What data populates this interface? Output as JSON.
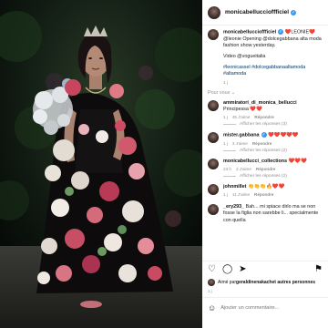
{
  "post": {
    "author": "monicabelluccioffficiel",
    "caption": {
      "author": "monicabelluccioffficiel",
      "text": "❤️LEONIE❤️ @leonie Opening @dolcegabbana alta moda fashion show yesterday.",
      "video_credit": "Video @vogueitalia",
      "hashtags": "#leonicassel #dolcegabbanaaltamoda #altamoda",
      "age": "1 j"
    },
    "sort_label": "Pour vous"
  },
  "comments": [
    {
      "user": "ammiratori_di_monica_bellucci",
      "text": "Principessa ❤️❤️",
      "age": "1 j",
      "likes": "45 J'aime",
      "reply": "Répondre",
      "replies": "Afficher les réponses (3)"
    },
    {
      "user": "mister.gabbana",
      "text": "❤️❤️❤️❤️❤️",
      "age": "1 j",
      "likes": "3 J'aime",
      "reply": "Répondre",
      "replies": "Afficher les réponses (2)"
    },
    {
      "user": "monicabellucci_collections",
      "text": "❤️❤️❤️",
      "age": "23 h",
      "likes": "2 J'aime",
      "reply": "Répondre",
      "replies": "Afficher les réponses (2)"
    },
    {
      "user": "johnmillet",
      "text": "👏👏👏🔥❤️❤️",
      "age": "1 j",
      "likes": "11 J'aime",
      "reply": "Répondre",
      "replies": ""
    },
    {
      "user": "_ery293_",
      "text": "Bah... mi spiace dirlo ma se non fosse la figlia non sarebbe li... specialmente con quella",
      "age": "",
      "likes": "",
      "reply": "",
      "replies": ""
    }
  ],
  "likes_line": {
    "prefix": "Aimé par ",
    "user": "geraldinenakach",
    "suffix": " et autres personnes"
  },
  "date": "1 j",
  "composer": {
    "placeholder": "Ajouter un commentaire..."
  }
}
